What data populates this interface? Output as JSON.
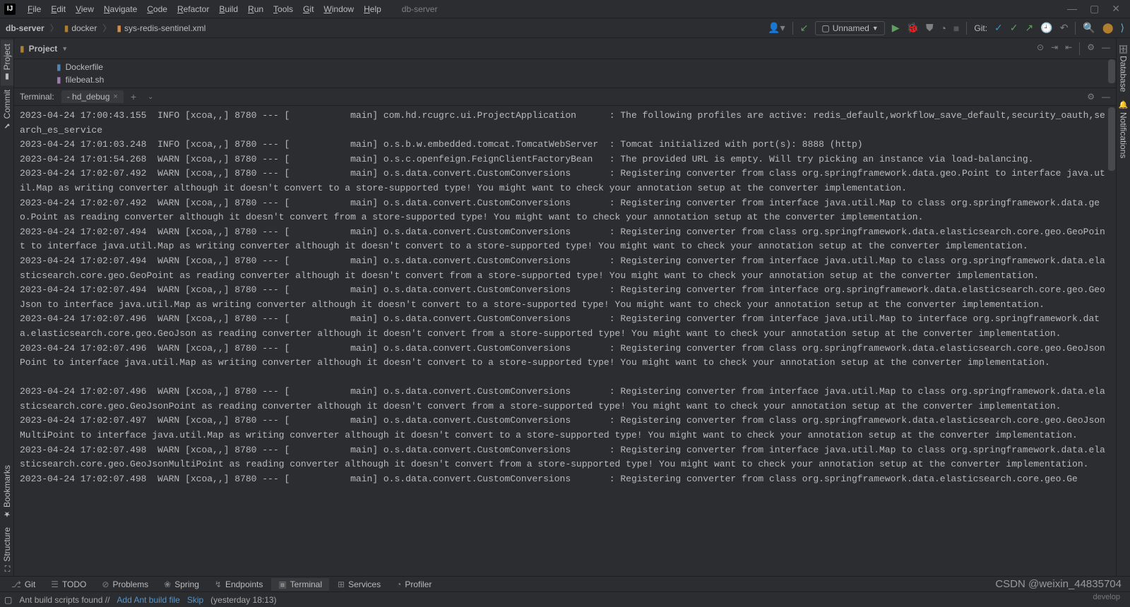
{
  "app_title": "db-server",
  "menus": [
    "File",
    "Edit",
    "View",
    "Navigate",
    "Code",
    "Refactor",
    "Build",
    "Run",
    "Tools",
    "Git",
    "Window",
    "Help"
  ],
  "breadcrumbs": {
    "project": "db-server",
    "folder": "docker",
    "file": "sys-redis-sentinel.xml"
  },
  "run_configuration": "Unnamed",
  "git_label": "Git:",
  "project_tool": {
    "title": "Project"
  },
  "project_files": [
    {
      "icon": "dockerfile-icon",
      "name": "Dockerfile"
    },
    {
      "icon": "sh-icon",
      "name": "filebeat.sh"
    }
  ],
  "left_rail": [
    {
      "name": "Project",
      "selected": true
    },
    {
      "name": "Commit"
    },
    {
      "name": "Bookmarks"
    },
    {
      "name": "Structure"
    }
  ],
  "right_rail": [
    {
      "name": "Database"
    },
    {
      "name": "Notifications"
    }
  ],
  "terminal": {
    "label": "Terminal:",
    "tab": "- hd_debug",
    "log_text": "2023-04-24 17:00:43.155  INFO [xcoa,,] 8780 --- [           main] com.hd.rcugrc.ui.ProjectApplication      : The following profiles are active: redis_default,workflow_save_default,security_oauth,search_es_service\n2023-04-24 17:01:03.248  INFO [xcoa,,] 8780 --- [           main] o.s.b.w.embedded.tomcat.TomcatWebServer  : Tomcat initialized with port(s): 8888 (http)\n2023-04-24 17:01:54.268  WARN [xcoa,,] 8780 --- [           main] o.s.c.openfeign.FeignClientFactoryBean   : The provided URL is empty. Will try picking an instance via load-balancing.\n2023-04-24 17:02:07.492  WARN [xcoa,,] 8780 --- [           main] o.s.data.convert.CustomConversions       : Registering converter from class org.springframework.data.geo.Point to interface java.util.Map as writing converter although it doesn't convert to a store-supported type! You might want to check your annotation setup at the converter implementation.\n2023-04-24 17:02:07.492  WARN [xcoa,,] 8780 --- [           main] o.s.data.convert.CustomConversions       : Registering converter from interface java.util.Map to class org.springframework.data.geo.Point as reading converter although it doesn't convert from a store-supported type! You might want to check your annotation setup at the converter implementation.\n2023-04-24 17:02:07.494  WARN [xcoa,,] 8780 --- [           main] o.s.data.convert.CustomConversions       : Registering converter from class org.springframework.data.elasticsearch.core.geo.GeoPoint to interface java.util.Map as writing converter although it doesn't convert to a store-supported type! You might want to check your annotation setup at the converter implementation.\n2023-04-24 17:02:07.494  WARN [xcoa,,] 8780 --- [           main] o.s.data.convert.CustomConversions       : Registering converter from interface java.util.Map to class org.springframework.data.elasticsearch.core.geo.GeoPoint as reading converter although it doesn't convert from a store-supported type! You might want to check your annotation setup at the converter implementation.\n2023-04-24 17:02:07.494  WARN [xcoa,,] 8780 --- [           main] o.s.data.convert.CustomConversions       : Registering converter from interface org.springframework.data.elasticsearch.core.geo.GeoJson to interface java.util.Map as writing converter although it doesn't convert to a store-supported type! You might want to check your annotation setup at the converter implementation.\n2023-04-24 17:02:07.496  WARN [xcoa,,] 8780 --- [           main] o.s.data.convert.CustomConversions       : Registering converter from interface java.util.Map to interface org.springframework.data.elasticsearch.core.geo.GeoJson as reading converter although it doesn't convert from a store-supported type! You might want to check your annotation setup at the converter implementation.\n2023-04-24 17:02:07.496  WARN [xcoa,,] 8780 --- [           main] o.s.data.convert.CustomConversions       : Registering converter from class org.springframework.data.elasticsearch.core.geo.GeoJsonPoint to interface java.util.Map as writing converter although it doesn't convert to a store-supported type! You might want to check your annotation setup at the converter implementation.\n\n2023-04-24 17:02:07.496  WARN [xcoa,,] 8780 --- [           main] o.s.data.convert.CustomConversions       : Registering converter from interface java.util.Map to class org.springframework.data.elasticsearch.core.geo.GeoJsonPoint as reading converter although it doesn't convert from a store-supported type! You might want to check your annotation setup at the converter implementation.\n2023-04-24 17:02:07.497  WARN [xcoa,,] 8780 --- [           main] o.s.data.convert.CustomConversions       : Registering converter from class org.springframework.data.elasticsearch.core.geo.GeoJsonMultiPoint to interface java.util.Map as writing converter although it doesn't convert to a store-supported type! You might want to check your annotation setup at the converter implementation.\n2023-04-24 17:02:07.498  WARN [xcoa,,] 8780 --- [           main] o.s.data.convert.CustomConversions       : Registering converter from interface java.util.Map to class org.springframework.data.elasticsearch.core.geo.GeoJsonMultiPoint as reading converter although it doesn't convert from a store-supported type! You might want to check your annotation setup at the converter implementation.\n2023-04-24 17:02:07.498  WARN [xcoa,,] 8780 --- [           main] o.s.data.convert.CustomConversions       : Registering converter from class org.springframework.data.elasticsearch.core.geo.Ge"
  },
  "bottom_tabs": [
    {
      "icon": "git-branch-icon",
      "label": "Git"
    },
    {
      "icon": "todo-icon",
      "label": "TODO"
    },
    {
      "icon": "problems-icon",
      "label": "Problems"
    },
    {
      "icon": "spring-icon",
      "label": "Spring"
    },
    {
      "icon": "endpoints-icon",
      "label": "Endpoints"
    },
    {
      "icon": "terminal-icon",
      "label": "Terminal",
      "active": true
    },
    {
      "icon": "services-icon",
      "label": "Services"
    },
    {
      "icon": "profiler-icon",
      "label": "Profiler"
    }
  ],
  "statusbar": {
    "msg": "Ant build scripts found //",
    "link1": "Add Ant build file",
    "link2": "Skip",
    "time": "(yesterday 18:13)"
  },
  "watermark": "CSDN @weixin_44835704",
  "watermark2": "develop"
}
